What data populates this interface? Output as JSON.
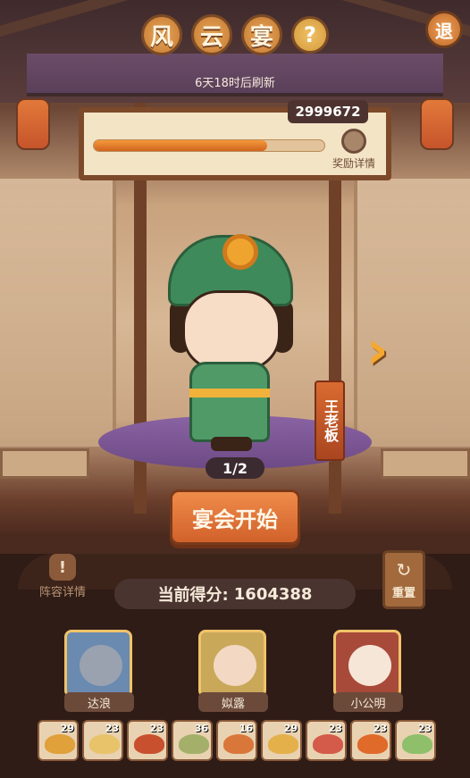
{
  "title_chars": [
    "风",
    "云",
    "宴"
  ],
  "help_label": "?",
  "back_label": "退",
  "refresh_text": "6天18时后刷新",
  "board": {
    "score": "2999672",
    "progress": 0.75,
    "reward_label": "奖励详情"
  },
  "character": {
    "name": "王老板",
    "page": "1/2",
    "next_symbol": "›"
  },
  "start_label": "宴会开始",
  "lineup_label": "阵容详情",
  "lineup_icon": "!",
  "reset_label": "重置",
  "reset_icon": "↻",
  "score_label": "当前得分:",
  "score_value": "1604388",
  "guests": [
    {
      "name": "达浪",
      "icon": "wolf-portrait"
    },
    {
      "name": "姒露",
      "icon": "girl-portrait"
    },
    {
      "name": "小公明",
      "icon": "opera-portrait"
    }
  ],
  "dishes": [
    {
      "count": "29",
      "color": "#e0a03a"
    },
    {
      "count": "23",
      "color": "#e8c36a"
    },
    {
      "count": "23",
      "color": "#c8502e"
    },
    {
      "count": "36",
      "color": "#a4b06a"
    },
    {
      "count": "16",
      "color": "#d9773a"
    },
    {
      "count": "29",
      "color": "#e4b04a"
    },
    {
      "count": "23",
      "color": "#d45a4a"
    },
    {
      "count": "23",
      "color": "#e06a2a"
    },
    {
      "count": "23",
      "color": "#8fbf6a"
    }
  ]
}
